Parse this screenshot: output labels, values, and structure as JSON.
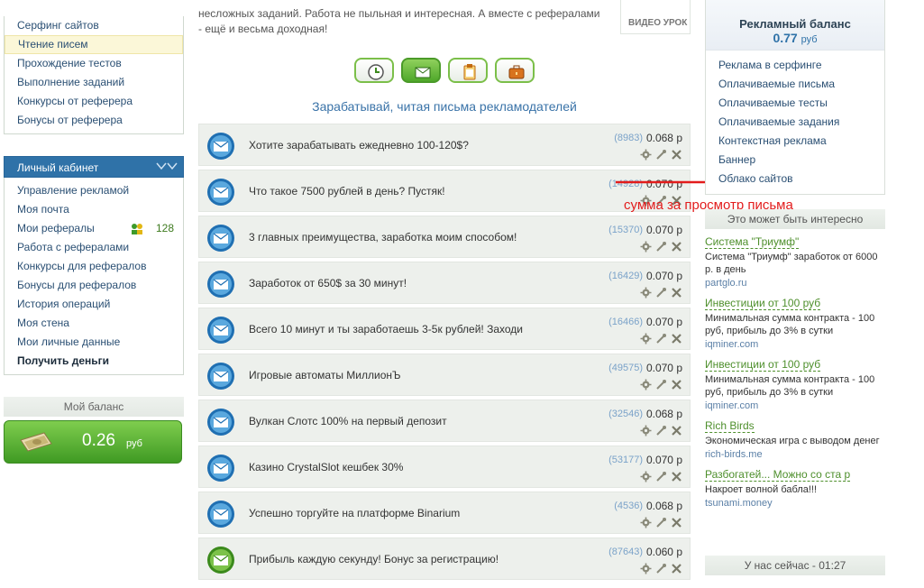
{
  "left_menu": {
    "items": [
      {
        "label": "Серфинг сайтов"
      },
      {
        "label": "Чтение писем"
      },
      {
        "label": "Прохождение тестов"
      },
      {
        "label": "Выполнение заданий"
      },
      {
        "label": "Конкурсы от реферера"
      },
      {
        "label": "Бонусы от реферера"
      }
    ]
  },
  "cabinet": {
    "title": "Личный кабинет",
    "items": [
      {
        "label": "Управление рекламой"
      },
      {
        "label": "Моя почта"
      },
      {
        "label": "Мои рефералы",
        "count": "128"
      },
      {
        "label": "Работа с рефералами"
      },
      {
        "label": "Конкурсы для рефералов"
      },
      {
        "label": "Бонусы для рефералов"
      },
      {
        "label": "История операций"
      },
      {
        "label": "Моя стена"
      },
      {
        "label": "Мои личные данные"
      },
      {
        "label": "Получить деньги"
      }
    ]
  },
  "my_balance": {
    "title": "Мой баланс",
    "amount": "0.26",
    "currency": "руб"
  },
  "intro": {
    "line1": "несложных заданий. Работа не пыльная и интересная. А вместе с рефералами",
    "line2": "- ещё и весьма доходная!"
  },
  "video_lesson": "ВИДЕО УРОК",
  "section_title": "Зарабатывай, читая письма рекламодателей",
  "annotation": "сумма за просмотр письма",
  "mails": [
    {
      "subject": "Хотите зарабатывать ежедневно 100-120$?",
      "views": "(8983)",
      "price": "0.068 р",
      "icon": "envelope-blue"
    },
    {
      "subject": "Что такое 7500 рублей в день? Пустяк!",
      "views": "(14928)",
      "price": "0.070 р",
      "icon": "envelope-blue"
    },
    {
      "subject": "3 главных преимущества, заработка моим способом!",
      "views": "(15370)",
      "price": "0.070 р",
      "icon": "envelope-blue"
    },
    {
      "subject": "Заработок от 650$ за 30 минут!",
      "views": "(16429)",
      "price": "0.070 р",
      "icon": "envelope-blue"
    },
    {
      "subject": "Всего 10 минут и ты заработаешь 3-5к рублей! Заходи",
      "views": "(16466)",
      "price": "0.070 р",
      "icon": "envelope-blue"
    },
    {
      "subject": "Игровые автоматы МиллионЪ",
      "views": "(49575)",
      "price": "0.070 р",
      "icon": "envelope-blue"
    },
    {
      "subject": "Вулкан Слотс 100% на первый депозит",
      "views": "(32546)",
      "price": "0.068 р",
      "icon": "envelope-blue"
    },
    {
      "subject": "Казино CrystalSlot кешбек 30%",
      "views": "(53177)",
      "price": "0.070 р",
      "icon": "envelope-blue"
    },
    {
      "subject": "Успешно торгуйте на платформе Binarium",
      "views": "(4536)",
      "price": "0.068 р",
      "icon": "envelope-blue"
    },
    {
      "subject": "Прибыль каждую секунду! Бонус за регистрацию!",
      "views": "(87643)",
      "price": "0.060 р",
      "icon": "envelope-green"
    }
  ],
  "ad_balance": {
    "title": "Рекламный баланс",
    "amount": "0.77",
    "currency": "руб",
    "links": [
      {
        "label": "Реклама в серфинге"
      },
      {
        "label": "Оплачиваемые письма"
      },
      {
        "label": "Оплачиваемые тесты"
      },
      {
        "label": "Оплачиваемые задания"
      },
      {
        "label": "Контекстная реклама"
      },
      {
        "label": "Баннер"
      },
      {
        "label": "Облако сайтов"
      }
    ]
  },
  "interesting": {
    "title": "Это может быть интересно",
    "ads": [
      {
        "title": "Система \"Триумф\"",
        "desc": "Система \"Триумф\" заработок от 6000 р. в день",
        "url": "partglo.ru"
      },
      {
        "title": "Инвестиции от 100 руб",
        "desc": "Минимальная сумма контракта - 100 руб, прибыль до 3% в сутки",
        "url": "iqminer.com"
      },
      {
        "title": "Инвестиции от 100 руб",
        "desc": "Минимальная сумма контракта - 100 руб, прибыль до 3% в сутки",
        "url": "iqminer.com"
      },
      {
        "title": "Rich Birds",
        "desc": "Экономическая игра с выводом денег",
        "url": "rich-birds.me"
      },
      {
        "title": "Разбогатей... Можно со ста р",
        "desc": "Накроет волной бабла!!!",
        "url": "tsunami.money"
      }
    ]
  },
  "now_label": "У нас сейчас - 01:27",
  "colors": {
    "accent_green": "#4fa82a",
    "accent_blue": "#2f72a8",
    "annotation_red": "#e21c1c"
  }
}
